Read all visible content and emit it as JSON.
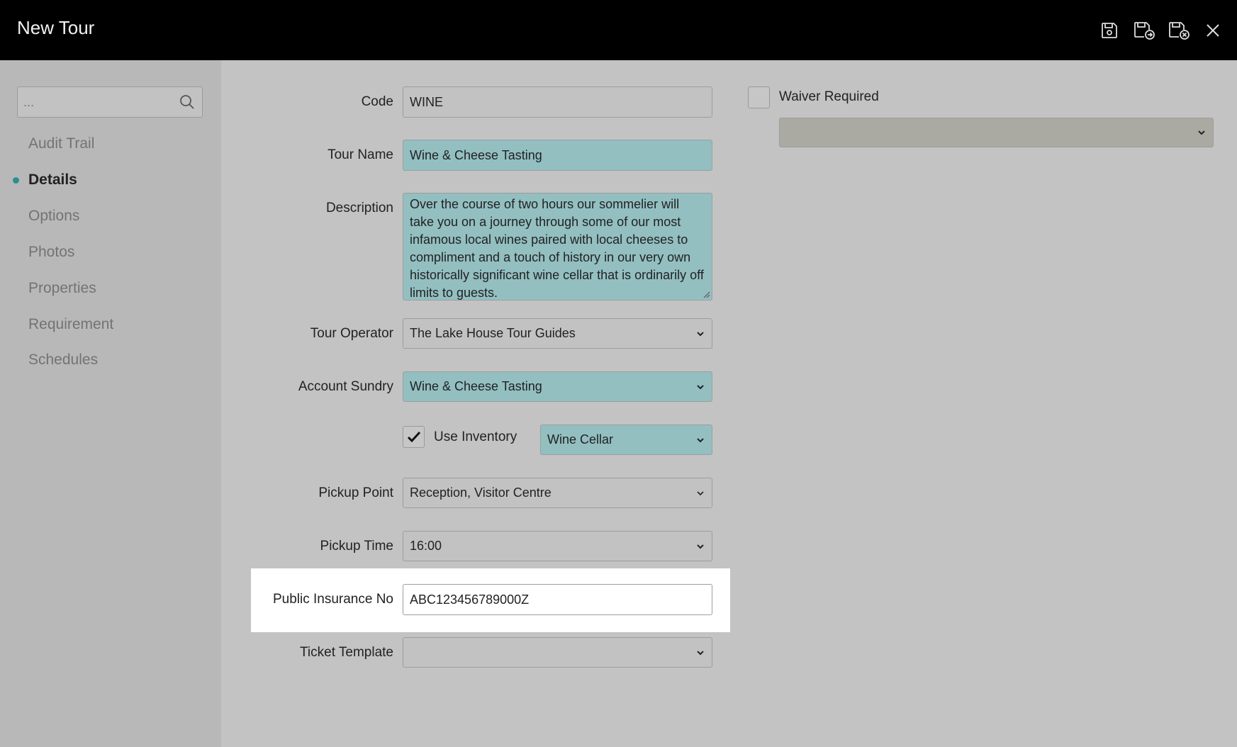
{
  "window": {
    "title": "New Tour",
    "actions": [
      "save-icon",
      "save-and-new-icon",
      "save-and-close-icon",
      "close-icon"
    ]
  },
  "sidebar": {
    "search_placeholder": "...",
    "items": [
      {
        "label": "Audit Trail",
        "active": false
      },
      {
        "label": "Details",
        "active": true
      },
      {
        "label": "Options",
        "active": false
      },
      {
        "label": "Photos",
        "active": false
      },
      {
        "label": "Properties",
        "active": false
      },
      {
        "label": "Requirement",
        "active": false
      },
      {
        "label": "Schedules",
        "active": false
      }
    ]
  },
  "form": {
    "code": {
      "label": "Code",
      "value": "WINE"
    },
    "tour_name": {
      "label": "Tour Name",
      "value": "Wine & Cheese Tasting"
    },
    "description": {
      "label": "Description",
      "value": "Over the course of two hours our sommelier will take you on a journey through some of our most infamous local wines paired with local cheeses to compliment and a touch of history in our very own historically significant wine cellar that is ordinarily off limits to guests."
    },
    "tour_operator": {
      "label": "Tour Operator",
      "value": "The Lake House Tour Guides"
    },
    "account_sundry": {
      "label": "Account Sundry",
      "value": "Wine & Cheese Tasting"
    },
    "use_inventory": {
      "label": "Use Inventory",
      "checked": true,
      "location": "Wine Cellar"
    },
    "pickup_point": {
      "label": "Pickup Point",
      "value": "Reception, Visitor Centre"
    },
    "pickup_time": {
      "label": "Pickup Time",
      "value": "16:00"
    },
    "public_insurance": {
      "label": "Public Insurance No",
      "value": "ABC123456789000Z"
    },
    "ticket_template": {
      "label": "Ticket Template",
      "value": ""
    },
    "waiver": {
      "label": "Waiver Required",
      "checked": false,
      "value": ""
    }
  },
  "colors": {
    "titlebar": "#000000",
    "accent": "#2a8f93",
    "required_field": "#93bfc1",
    "background": "#c3c3c3"
  }
}
